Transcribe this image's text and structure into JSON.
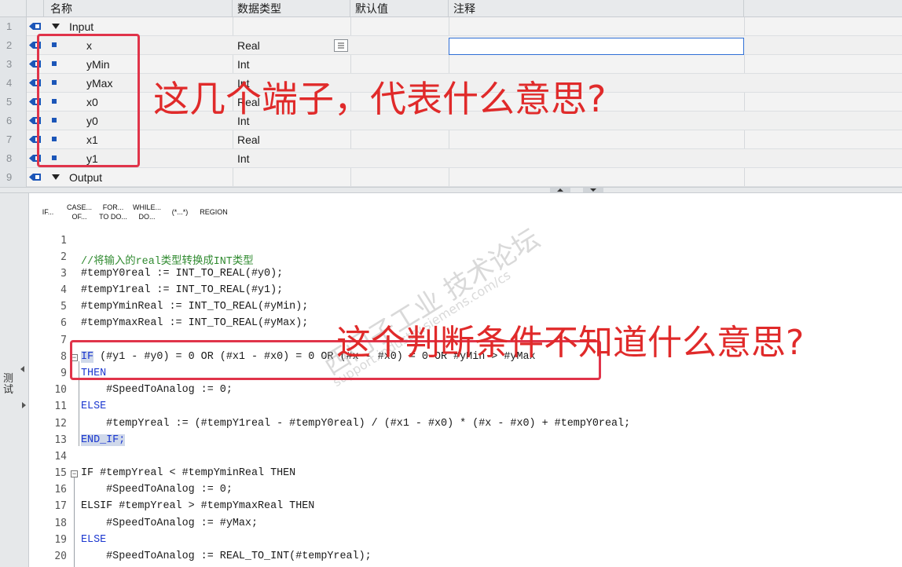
{
  "table": {
    "headers": {
      "name": "名称",
      "type": "数据类型",
      "default": "默认值",
      "comment": "注释"
    },
    "rows": [
      {
        "num": "1",
        "name": "Input",
        "type": ""
      },
      {
        "num": "2",
        "name": "x",
        "type": "Real"
      },
      {
        "num": "3",
        "name": "yMin",
        "type": "Int"
      },
      {
        "num": "4",
        "name": "yMax",
        "type": "Int"
      },
      {
        "num": "5",
        "name": "x0",
        "type": "Real"
      },
      {
        "num": "6",
        "name": "y0",
        "type": "Int"
      },
      {
        "num": "7",
        "name": "x1",
        "type": "Real"
      },
      {
        "num": "8",
        "name": "y1",
        "type": "Int"
      },
      {
        "num": "9",
        "name": "Output",
        "type": ""
      }
    ]
  },
  "toolbar": {
    "if": "IF...",
    "case_1": "CASE...",
    "case_2": "OF...",
    "for_1": "FOR...",
    "for_2": "TO DO...",
    "while_1": "WHILE...",
    "while_2": "DO...",
    "comment": "(*...*)",
    "region": "REGION"
  },
  "sidebar_label": "测试",
  "code": {
    "line_numbers": [
      "1",
      "2",
      "3",
      "4",
      "5",
      "6",
      "7",
      "8",
      "9",
      "10",
      "11",
      "12",
      "13",
      "14",
      "15",
      "16",
      "17",
      "18",
      "19",
      "20"
    ],
    "l2": "//将输入的real类型转换成INT类型",
    "l3": "#tempY0real := INT_TO_REAL(#y0);",
    "l4": "#tempY1real := INT_TO_REAL(#y1);",
    "l5": "#tempYminReal := INT_TO_REAL(#yMin);",
    "l6": "#tempYmaxReal := INT_TO_REAL(#yMax);",
    "l8_kw": "IF",
    "l8_rest": " (#y1 - #y0) = 0 OR (#x1 - #x0) = 0 OR (#x - #x0) = 0 OR #yMin > #yMax",
    "l9": "THEN",
    "l10": "    #SpeedToAnalog := 0;",
    "l11": "ELSE",
    "l12": "    #tempYreal := (#tempY1real - #tempY0real) / (#x1 - #x0) * (#x - #x0) + #tempY0real;",
    "l13": "END_IF;",
    "l15": "IF #tempYreal < #tempYminReal THEN",
    "l16": "    #SpeedToAnalog := 0;",
    "l17": "ELSIF #tempYreal > #tempYmaxReal THEN",
    "l18": "    #SpeedToAnalog := #yMax;",
    "l19": "ELSE",
    "l20": "    #SpeedToAnalog := REAL_TO_INT(#tempYreal);"
  },
  "annotations": {
    "pins_question": "这几个端子，代表什么意思?",
    "condition_question": "这个判断条件不知道什么意思?"
  },
  "watermark": {
    "cn": "西门子工业 技术论坛",
    "url": "support.industry.siemens.com/cs"
  },
  "colors": {
    "annotation_red": "#e02a2a",
    "keyword_blue": "#1c38d0",
    "comment_green": "#2f8a2f"
  }
}
